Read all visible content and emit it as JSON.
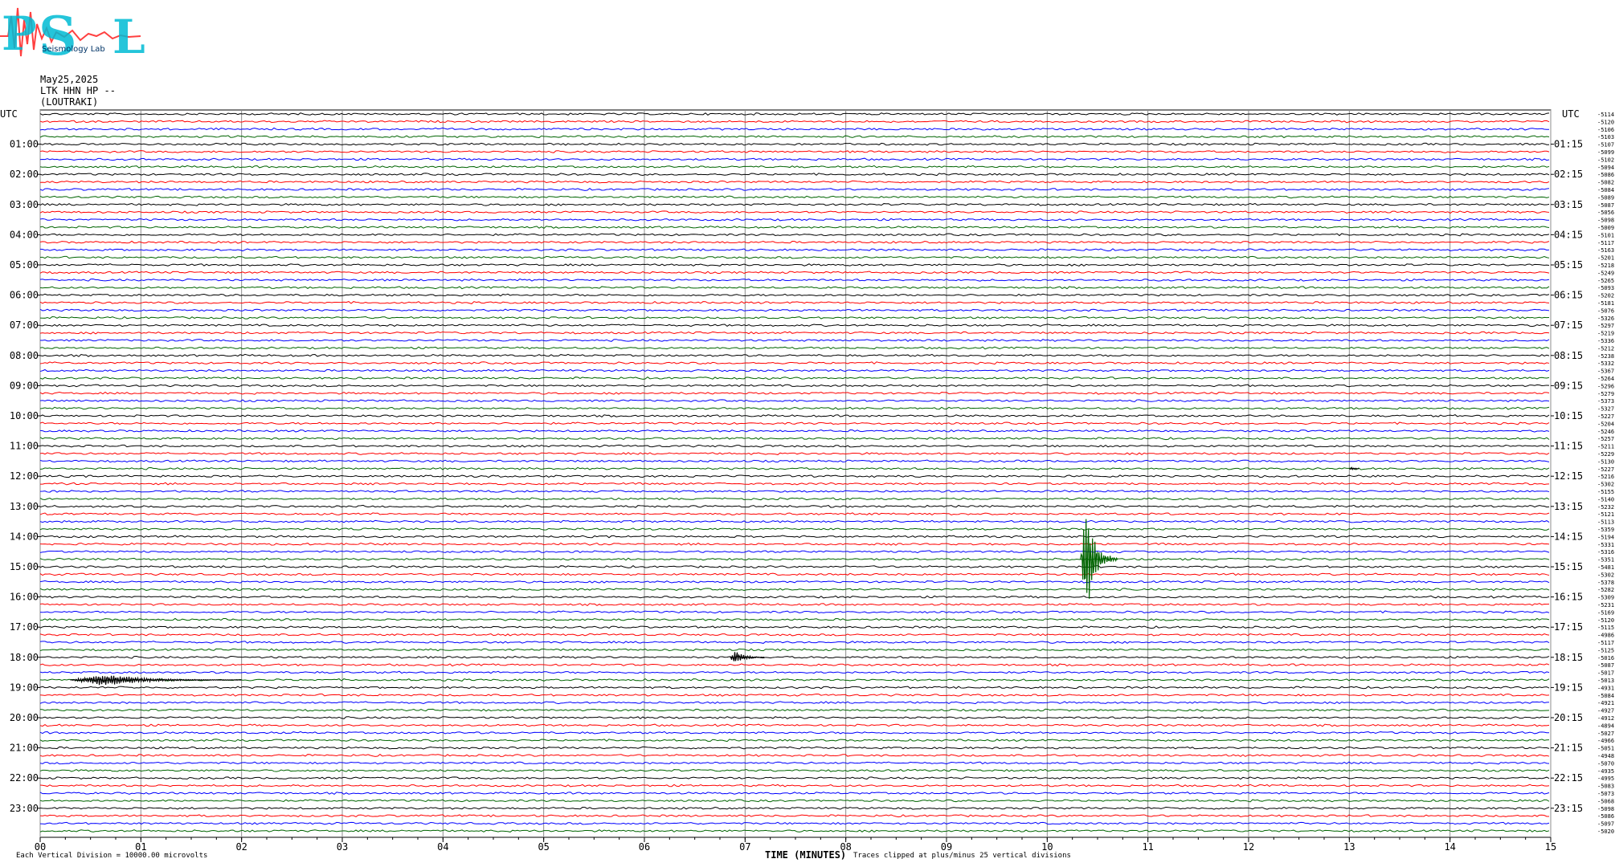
{
  "header": {
    "logo_text": "PSL",
    "logo_subtext": "Seismology Lab",
    "date": "May25,2025",
    "channel": "LTK HHN HP --",
    "station": "(LOUTRAKI)"
  },
  "footer": {
    "left_note": "Each Vertical Division = 10000.00 microvolts",
    "xlabel": "TIME (MINUTES)",
    "clip_note": "Traces clipped at plus/minus 25 vertical divisions"
  },
  "chart_data": {
    "type": "line",
    "title": "",
    "xlabel": "TIME (MINUTES)",
    "ylabel": "",
    "xlim": [
      0,
      15
    ],
    "x_ticks": [
      "00",
      "01",
      "02",
      "03",
      "04",
      "05",
      "06",
      "07",
      "08",
      "09",
      "10",
      "11",
      "12",
      "13",
      "14",
      "15"
    ],
    "y_axis_left_title": "UTC",
    "y_axis_right_title": "UTC",
    "left_hour_labels": [
      "01:00",
      "02:00",
      "03:00",
      "04:00",
      "05:00",
      "06:00",
      "07:00",
      "08:00",
      "09:00",
      "10:00",
      "11:00",
      "12:00",
      "13:00",
      "14:00",
      "15:00",
      "16:00",
      "17:00",
      "18:00",
      "19:00",
      "20:00",
      "21:00",
      "22:00",
      "23:00"
    ],
    "right_hour_labels": [
      "01:15",
      "02:15",
      "03:15",
      "04:15",
      "05:15",
      "06:15",
      "07:15",
      "08:15",
      "09:15",
      "10:15",
      "11:15",
      "12:15",
      "13:15",
      "14:15",
      "15:15",
      "16:15",
      "17:15",
      "18:15",
      "19:15",
      "20:15",
      "21:15",
      "22:15",
      "23:15"
    ],
    "traces_per_hour": 4,
    "trace_colors": [
      "#000000",
      "#ff0000",
      "#0000ff",
      "#006400"
    ],
    "right_offsets": [
      "-5114",
      "-5120",
      "-5106",
      "-5103",
      "-5107",
      "-5099",
      "-5102",
      "-5094",
      "-5086",
      "-5082",
      "-5084",
      "-5089",
      "-5087",
      "-5056",
      "-5098",
      "-5009",
      "-5101",
      "-5117",
      "-5163",
      "-5201",
      "-5218",
      "-5249",
      "-5265",
      "-5093",
      "-5202",
      "-5181",
      "-5076",
      "-5326",
      "-5297",
      "-5219",
      "-5336",
      "-5212",
      "-5238",
      "-5332",
      "-5367",
      "-5264",
      "-5296",
      "-5279",
      "-5373",
      "-5327",
      "-5227",
      "-5204",
      "-5246",
      "-5257",
      "-5211",
      "-5229",
      "-5130",
      "-5227",
      "-5216",
      "-5302",
      "-5155",
      "-5140",
      "-5232",
      "-5121",
      "-5113",
      "-5359",
      "-5194",
      "-5331",
      "-5316",
      "-5351",
      "-5481",
      "-5302",
      "-5378",
      "-5282",
      "-5309",
      "-5231",
      "-5169",
      "-5120",
      "-5115",
      "-4986",
      "-5117",
      "-5125",
      "-5016",
      "-5087",
      "-5017",
      "-5013",
      "-4931",
      "-5084",
      "-4921",
      "-4927",
      "-4912",
      "-4894",
      "-5027",
      "-4966",
      "-5051",
      "-4948",
      "-5070",
      "-4935",
      "-4995",
      "-5083",
      "-5073",
      "-5068",
      "-5098",
      "-5086",
      "-5097",
      "-5020"
    ],
    "events": [
      {
        "trace_index": 75,
        "start_min": 0.3,
        "peak_min": 0.65,
        "end_min": 2.0,
        "amplitude_divisions": 0.9,
        "color": "#000000"
      },
      {
        "trace_index": 72,
        "start_min": 6.85,
        "peak_min": 6.9,
        "end_min": 7.2,
        "amplitude_divisions": 1.2,
        "color": "#000000"
      },
      {
        "trace_index": 59,
        "start_min": 10.33,
        "peak_min": 10.38,
        "end_min": 10.7,
        "amplitude_divisions": 10,
        "color": "#006400"
      },
      {
        "trace_index": 47,
        "start_min": 13.0,
        "peak_min": 13.02,
        "end_min": 13.1,
        "amplitude_divisions": 0.3,
        "color": "#000000"
      }
    ]
  }
}
